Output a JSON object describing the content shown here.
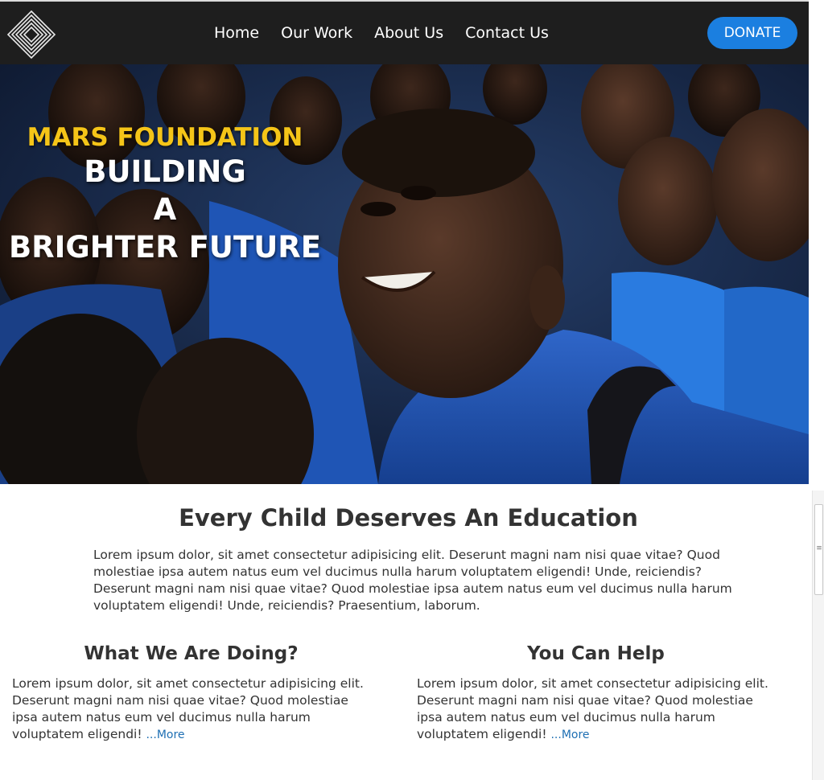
{
  "nav": {
    "links": [
      "Home",
      "Our Work",
      "About Us",
      "Contact Us"
    ],
    "donate_label": "DONATE"
  },
  "hero": {
    "kicker": "MARS FOUNDATION",
    "line1": "BUILDING",
    "line2": "A",
    "line3": "BRIGHTER FUTURE"
  },
  "intro": {
    "title": "Every Child Deserves An Education",
    "paragraph1": "Lorem ipsum dolor, sit amet consectetur adipisicing elit. Deserunt magni nam nisi quae vitae? Quod molestiae ipsa autem natus eum vel ducimus nulla harum voluptatem eligendi! Unde, reiciendis?",
    "paragraph2": "Deserunt magni nam nisi quae vitae? Quod molestiae ipsa autem natus eum vel ducimus nulla harum voluptatem eligendi! Unde, reiciendis? Praesentium, laborum."
  },
  "doing": {
    "title": "What We Are Doing?",
    "text": "Lorem ipsum dolor, sit amet consectetur adipisicing elit. Deserunt magni nam nisi quae vitae? Quod molestiae ipsa autem natus eum vel ducimus nulla harum voluptatem eligendi!",
    "more": "...More"
  },
  "help": {
    "title": "You Can Help",
    "text": "Lorem ipsum dolor, sit amet consectetur adipisicing elit. Deserunt magni nam nisi quae vitae? Quod molestiae ipsa autem natus eum vel ducimus nulla harum voluptatem eligendi!",
    "more": "...More"
  },
  "icons": {
    "logo": "diamond-logo-icon",
    "scroll_grip": "scroll-grip-icon"
  },
  "colors": {
    "nav_bg": "#1e1e1e",
    "donate": "#1b7fe0",
    "kicker": "#f5c518",
    "link": "#1e6fb3"
  }
}
